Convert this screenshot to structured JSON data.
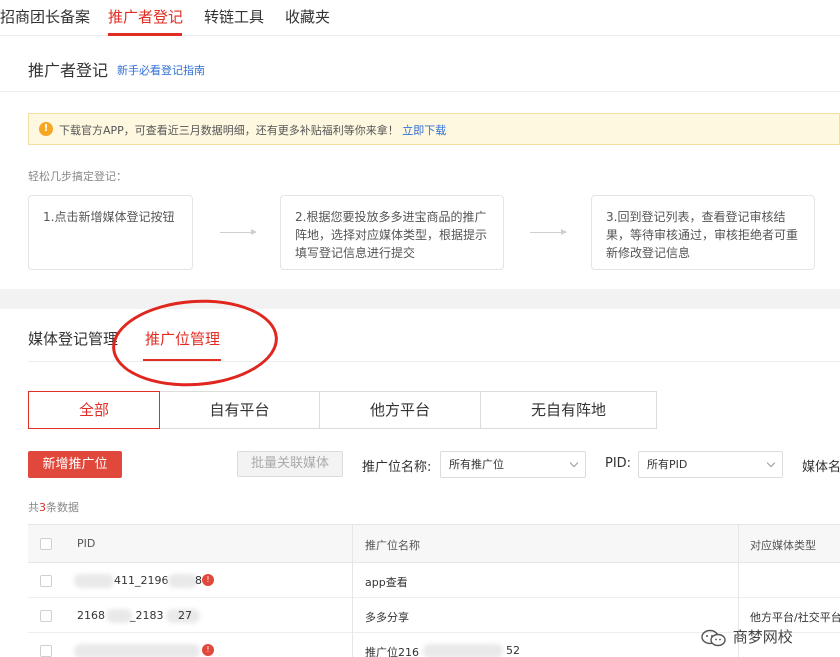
{
  "topnav": {
    "tabs": [
      {
        "label": "招商团长备案"
      },
      {
        "label": "推广者登记"
      },
      {
        "label": "转链工具"
      },
      {
        "label": "收藏夹"
      }
    ]
  },
  "header": {
    "title": "推广者登记",
    "guide_link": "新手必看登记指南"
  },
  "notice": {
    "text": "下载官方APP，可查看近三月数据明细，还有更多补贴福利等你来拿！",
    "link": "立即下载"
  },
  "steps": {
    "label": "轻松几步搞定登记：",
    "items": [
      {
        "text": "1.点击新增媒体登记按钮"
      },
      {
        "text": "2.根据您要投放多多进宝商品的推广阵地，选择对应媒体类型，根据提示填写登记信息进行提交"
      },
      {
        "text": "3.回到登记列表，查看登记审核结果，等待审核通过，审核拒绝者可重新修改登记信息"
      }
    ]
  },
  "subtabs": [
    {
      "label": "媒体登记管理"
    },
    {
      "label": "推广位管理"
    }
  ],
  "segments": [
    {
      "label": "全部"
    },
    {
      "label": "自有平台"
    },
    {
      "label": "他方平台"
    },
    {
      "label": "无自有阵地"
    }
  ],
  "toolbar": {
    "add_label": "新增推广位",
    "batch_label": "批量关联媒体",
    "name_filter_label": "推广位名称:",
    "name_filter_value": "所有推广位",
    "pid_filter_label": "PID:",
    "pid_filter_value": "所有PID",
    "media_filter_label": "媒体名"
  },
  "count": {
    "prefix": "共",
    "number": "3",
    "suffix": "条数据"
  },
  "table": {
    "columns": [
      "PID",
      "推广位名称",
      "对应媒体类型"
    ],
    "rows": [
      {
        "pid_tail": "411_2196",
        "pid_end": "8",
        "name": "app查看",
        "media": ""
      },
      {
        "pid_start": "2168",
        "pid_mid": "_2183",
        "pid_end": "27",
        "name": "多多分享",
        "media": "他方平台/社交平台"
      },
      {
        "pid_start": "",
        "pid_end": "",
        "name": "推广位216",
        "name_end": "52",
        "media": ""
      }
    ]
  },
  "watermark": {
    "text": "商梦网校"
  },
  "colors": {
    "accent": "#e02e24",
    "link": "#2e6fd6",
    "notice_bg": "#fff8e1"
  }
}
